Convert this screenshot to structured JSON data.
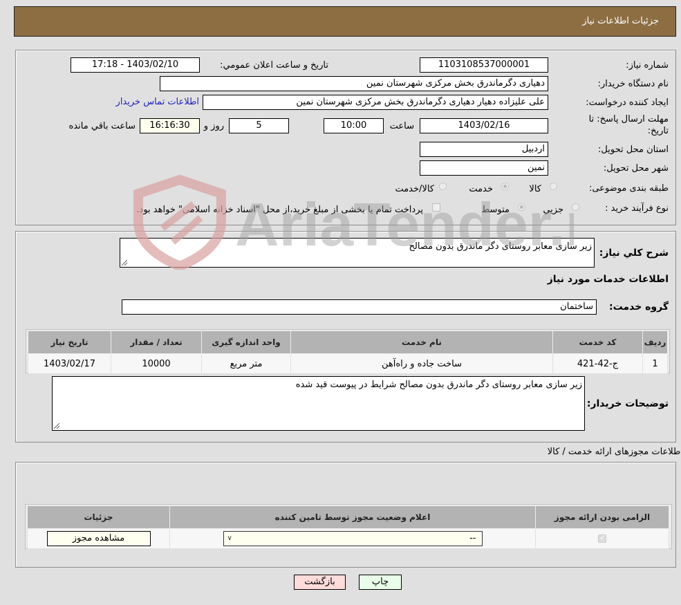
{
  "header": {
    "title": "جزئیات اطلاعات نیاز"
  },
  "details": {
    "need_number_label": "شماره نیاز:",
    "need_number": "1103108537000001",
    "announce_label": "تاریخ و ساعت اعلان عمومي:",
    "announce_value": "1403/02/10 - 17:18",
    "buyer_org_label": "نام دستگاه خریدار:",
    "buyer_org": "دهیاری دگرماندرق بخش مرکزی شهرستان نمین",
    "creator_label": "ایجاد کننده درخواست:",
    "creator": "علی علیزاده دهیار دهیاری دگرماندرق بخش مرکزی شهرستان نمین",
    "contact_link": "اطلاعات تماس خریدار",
    "deadline_label": "مهلت ارسال پاسخ: تا تاریخ:",
    "deadline_date": "1403/02/16",
    "time_label": "ساعت",
    "deadline_time": "10:00",
    "days_value": "5",
    "days_label": "روز و",
    "remaining_time": "16:16:30",
    "remaining_label": "ساعت باقي مانده",
    "province_label": "استان محل تحویل:",
    "province": "اردبیل",
    "city_label": "شهر محل تحویل:",
    "city": "نمین",
    "category_label": "طبقه بندی موضوعی:",
    "category_options": [
      "کالا",
      "خدمت",
      "کالا/خدمت"
    ],
    "category_selected": "خدمت",
    "process_label": "نوع فرآیند خرید :",
    "process_options": [
      "جزیي",
      "متوسط"
    ],
    "process_selected": "متوسط",
    "treasury_note": "پرداخت تمام یا بخشی از مبلغ خرید،از محل \"اسناد خزانه اسلامی\" خواهد بود."
  },
  "description": {
    "label": "شرح کلي نیاز:",
    "value": "زیر سازی معابر روستای دگر ماندرق بدون مصالح",
    "services_title": "اطلاعات خدمات مورد نیاز",
    "service_group_label": "گروه خدمت:",
    "service_group": "ساختمان"
  },
  "services_table": {
    "headers": [
      "ردیف",
      "کد خدمت",
      "نام خدمت",
      "واحد اندازه گیری",
      "تعداد / مقدار",
      "تاریخ نیاز"
    ],
    "rows": [
      [
        "1",
        "ج-42-421",
        "ساخت جاده و راه‌آهن",
        "متر مربع",
        "10000",
        "1403/02/17"
      ]
    ]
  },
  "buyer_notes": {
    "label": "توضیحات خریدار:",
    "value": "زیر سازی معابر روستای دگر ماندرق بدون مصالح شرایط در پیوست قید شده"
  },
  "permits": {
    "title": "اطلاعات مجوزهای ارائه خدمت / کالا",
    "headers": [
      "الزامی بودن ارائه مجوز",
      "اعلام وضعیت مجوز توسط تامین کننده",
      "جزئیات"
    ],
    "select_value": "--",
    "view_button": "مشاهده مجوز",
    "required_checked": true
  },
  "actions": {
    "print": "چاپ",
    "back": "بازگشت"
  },
  "watermark": {
    "text": "AriaTender.neT"
  }
}
